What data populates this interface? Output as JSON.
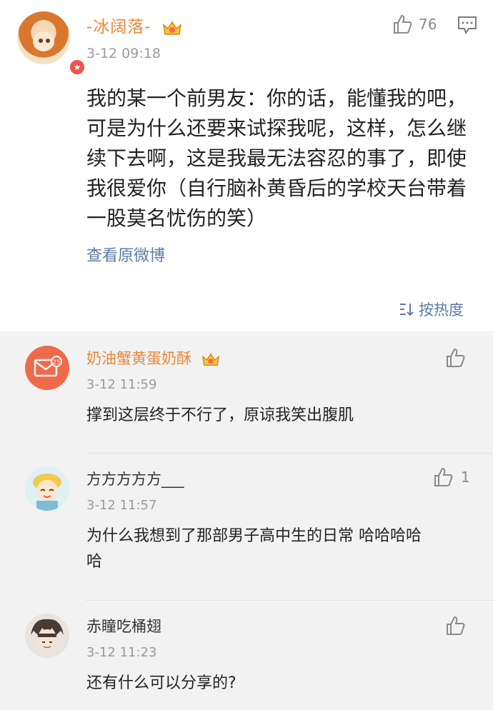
{
  "post": {
    "username": "-冰阔落-",
    "timestamp": "3-12 09:18",
    "like_count": "76",
    "text": "我的某一个前男友：你的话，能懂我的吧，可是为什么还要来试探我呢，这样，怎么继续下去啊，这是我最无法容忍的事了，即使我很爱你（自行脑补黄昏后的学校天台带着一股莫名忧伤的笑）",
    "view_original_label": "查看原微博",
    "sort_label": "按热度"
  },
  "comments": [
    {
      "username": "奶油蟹黄蛋奶酥",
      "timestamp": "3-12 11:59",
      "text": "撑到这层终于不行了，原谅我笑出腹肌",
      "like_count": ""
    },
    {
      "username": "方方方方方___",
      "timestamp": "3-12 11:57",
      "text": "为什么我想到了那部男子高中生的日常 哈哈哈哈哈",
      "like_count": "1"
    },
    {
      "username": "赤瞳吃桶翅",
      "timestamp": "3-12 11:23",
      "text": "还有什么可以分享的?",
      "like_count": ""
    }
  ],
  "colors": {
    "vip_name": "#e8883a",
    "link": "#5a7ca6",
    "muted": "#9a9a9a",
    "comments_bg": "#f2f2f2"
  }
}
